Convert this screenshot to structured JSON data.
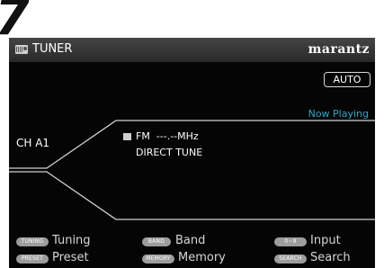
{
  "step_number": "7",
  "header": {
    "icon": "tuner-icon",
    "title": "TUNER",
    "brand": "marantz"
  },
  "mode_badge": "AUTO",
  "status": "Now Playing",
  "channel": "CH A1",
  "station": {
    "icon": "fm-icon",
    "band_freq": "FM  ---.--MHz",
    "mode": "DIRECT TUNE"
  },
  "keys": [
    {
      "badge": "TUNING",
      "label": "Tuning"
    },
    {
      "badge": "BAND",
      "label": "Band"
    },
    {
      "badge": "0~9",
      "label": "Input"
    },
    {
      "badge": "PRESET",
      "label": "Preset"
    },
    {
      "badge": "MEMORY",
      "label": "Memory"
    },
    {
      "badge": "SEARCH",
      "label": "Search"
    }
  ],
  "colors": {
    "screen_bg": "#050505",
    "titlebar": "#3a3a3a",
    "accent": "#2aa8c8",
    "key_badge": "#9d9d9d"
  }
}
